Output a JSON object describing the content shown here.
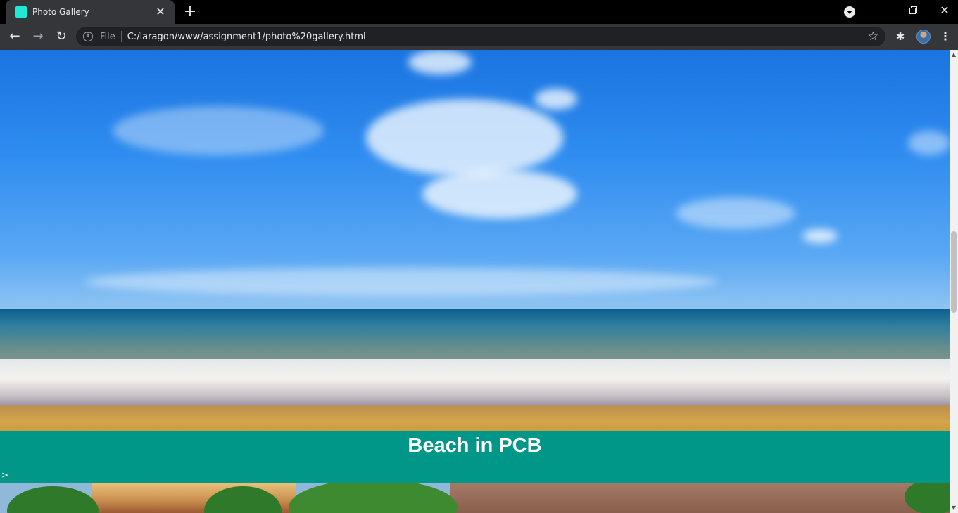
{
  "browser": {
    "tab": {
      "title": "Photo Gallery",
      "close_glyph": "✕"
    },
    "new_tab_glyph": "+",
    "window_controls": {
      "close_glyph": "✕"
    },
    "toolbar": {
      "back_glyph": "←",
      "forward_glyph": "→",
      "reload_glyph": "↻",
      "info_glyph": "i",
      "scheme_label": "File",
      "url": "C:/laragon/www/assignment1/photo%20gallery.html",
      "star_glyph": "☆",
      "extensions_glyph": "✱",
      "menu_glyph": "⋮"
    }
  },
  "page": {
    "photo": {
      "caption": "Beach in PCB"
    },
    "stray_text": ">"
  },
  "colors": {
    "caption_band": "#009688",
    "tab_favicon": "#1de9d6",
    "chrome_dark": "#35363a"
  },
  "scrollbar": {
    "up_glyph": "▲",
    "down_glyph": "▼"
  }
}
